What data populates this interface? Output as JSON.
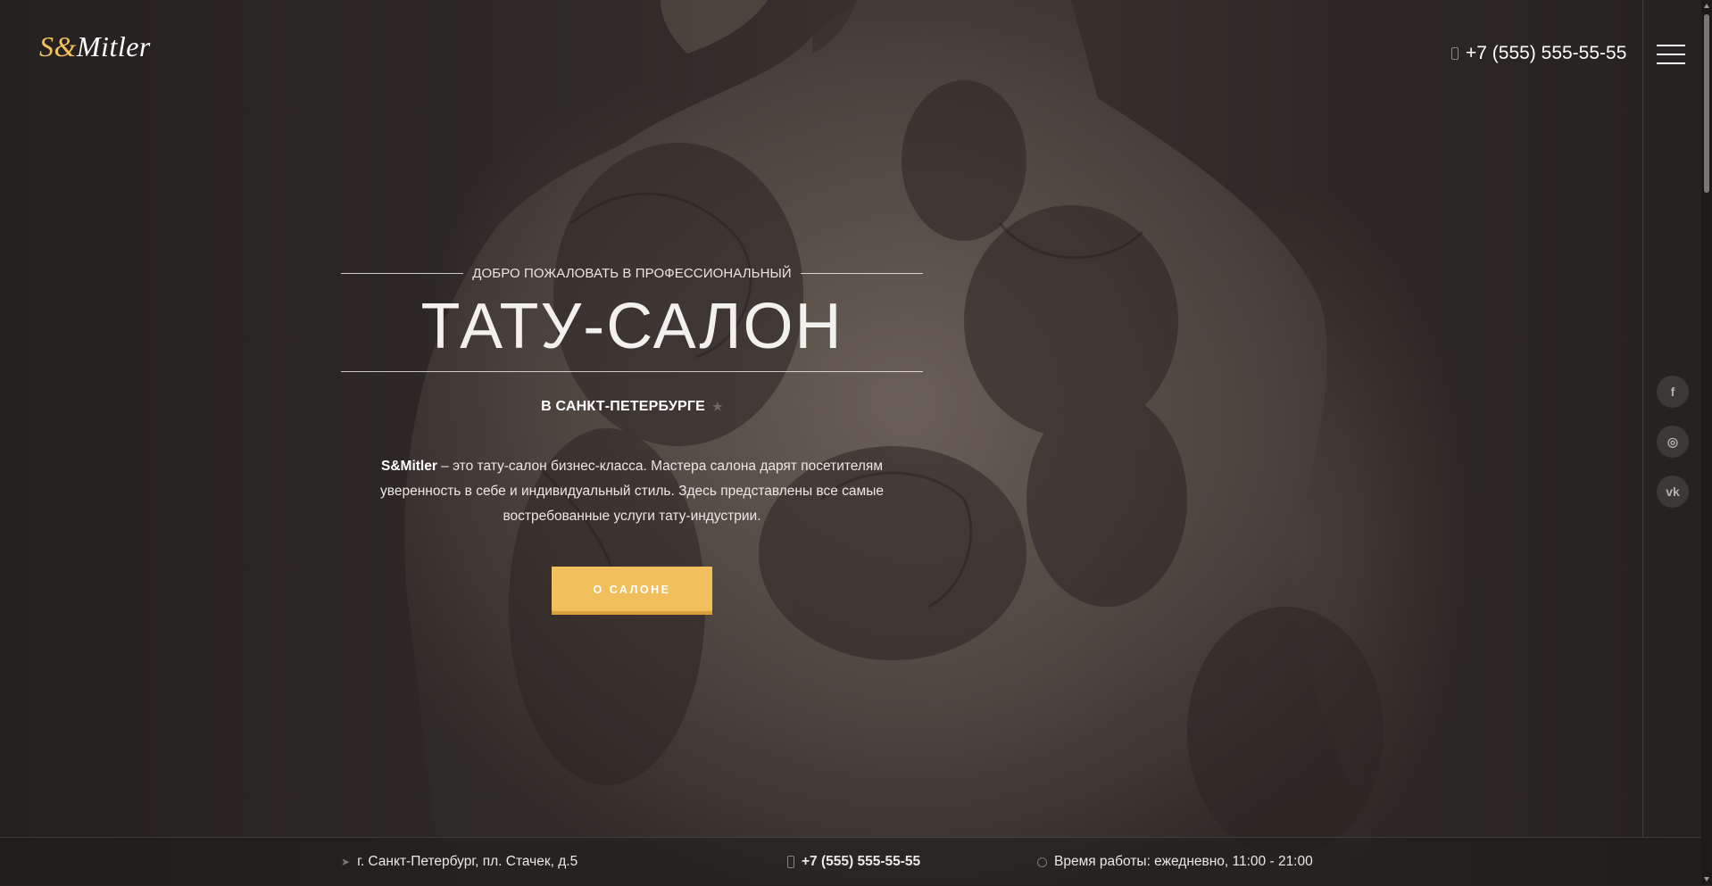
{
  "header": {
    "logo": {
      "s": "S",
      "amp": "&",
      "rest": "Mitler"
    },
    "phone": "+7 (555) 555-55-55"
  },
  "hero": {
    "welcome": "ДОБРО ПОЖАЛОВАТЬ В ПРОФЕССИОНАЛЬНЫЙ",
    "title": "ТАТУ-САЛОН",
    "subtitle": "В САНКТ-ПЕТЕРБУРГЕ",
    "description_brand": "S&Mitler",
    "description_text": " – это тату-салон бизнес-класса. Мастера салона дарят посетителям уверенность в себе и индивидуальный стиль. Здесь представлены все самые востребованные услуги тату-индустрии.",
    "cta_label": "О САЛОНЕ"
  },
  "social": [
    {
      "name": "facebook",
      "glyph": "f"
    },
    {
      "name": "instagram",
      "glyph": "◎"
    },
    {
      "name": "vk",
      "glyph": "vk"
    }
  ],
  "footer": {
    "address": "г. Санкт-Петербург, пл. Стачек, д.5",
    "phone": "+7 (555) 555-55-55",
    "hours": "Время работы: ежедневно, 11:00 - 21:00"
  },
  "colors": {
    "accent": "#f2bf5d",
    "background": "#2a2624"
  }
}
